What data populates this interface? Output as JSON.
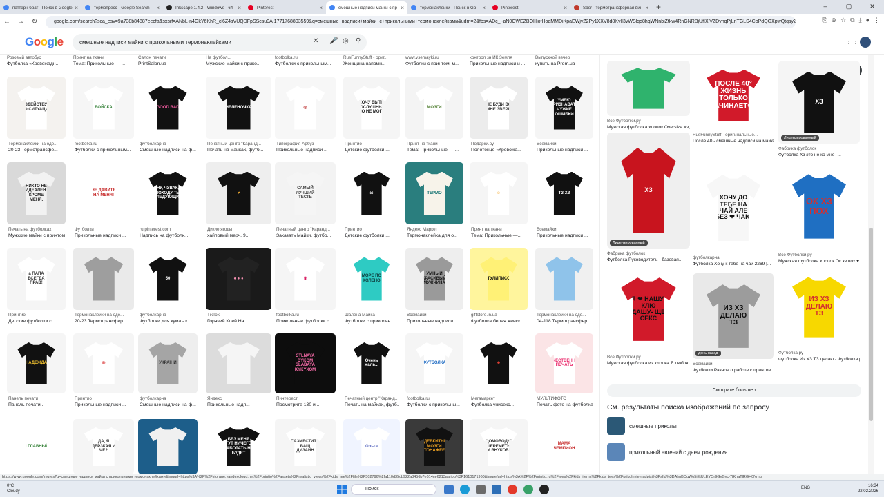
{
  "tabs": [
    {
      "title": "паттерн брат - Поиск в Google",
      "color": "#4285f4"
    },
    {
      "title": "термопресс - Google Search",
      "color": "#4285f4"
    },
    {
      "title": "Inkscape 1.4.2 - Windows - 64 -",
      "color": "#222222"
    },
    {
      "title": "Pinterest",
      "color": "#e60023"
    },
    {
      "title": "смешные надписи майки с пр",
      "color": "#4285f4"
    },
    {
      "title": "термонаклейки - Поиск в Go",
      "color": "#4285f4"
    },
    {
      "title": "Pinterest",
      "color": "#e60023"
    },
    {
      "title": "Sber - термотрансферная вин",
      "color": "#c0392b"
    }
  ],
  "window_controls": [
    "–",
    "▢",
    "✕"
  ],
  "address": {
    "url": "google.com/search?sca_esv=9a738b84887eecfa&sxsrf=ANbL-n4GkY6KhR_cl6Z4sVUQDFpSScsu0A:1771768803559&q=смешные+надписи+майки+с+прикольными+термонаклейками&udm=2&fbs=ADc_l-aN0CWEZBOHjofHoaMMDiKpaEWjvZ2Py1XXV8d8KvlI3vWSlqd8hqWNnbiZtkw4RnGNRBjUfIXiVZDvnqPjLnTGLS4CoPdQGXpwQtqsyZ84_ZWmpPpvwdl2dlNNdzrnETaAPpUeg6Mby_mwSwP-uaSHUNzd_q9XsYX8sJ7JIfhaaKPn8Z1MjPSi2hjRlNBxWtZY&sa=X&ved=2ahUKEwiZ5tGxitqSAxXLFBAIHdY9AIAQtKgLegQIEhAB&biw=1280&bih=720&dpr=1.5#vhid=ALYpb_ncDc7jTlmw6Mmq7NjuX5c-GJ1bPa4iXHT6GKBu-8TSmBbK7h36E7nAzGveWQCpQaLoTwnDwyEH_w_sfZ5vFUqcv_wXXPdX_tpUWwKaASDHNmpWc"
  },
  "google": {
    "logo": "Google",
    "query": "смешные надписи майки с прикольными термонаклейками"
  },
  "grid_top": {
    "sources": [
      "Розовый автобус",
      "Принт на ткани",
      "Салон печати",
      "На футбол...",
      "footbolka.ru",
      "RusFunnyStuff - ориг...",
      "www.vsemayki.ru",
      "контрол зн ИК Земля",
      "Выпускной вечер"
    ],
    "titles": [
      "Футболка «Кровожадн...",
      "Тема: Прикольные — ...",
      "PrintSalon.ua",
      "Мужские майки с прико...",
      "Футболки с прикольным...",
      "Женщина напомн...",
      "Футболки с принтом, м...",
      "Прикольные надписи и ...",
      "купить на Prom.ua"
    ]
  },
  "rows": [
    [
      {
        "bg": "#f4f2ef",
        "shirt": "#ffffff",
        "ink": "#333",
        "text": "БЕЗДЕЙСТВУЕМ ПО СИТУАЦИИ",
        "src": "Термонаклейки на оде...",
        "ttl": "20-23 Термотрансфе..."
      },
      {
        "bg": "#f6f6f6",
        "shirt": "#ffffff",
        "ink": "#2e7d32",
        "text": "ВОЙСКА",
        "src": "footbolka.ru",
        "ttl": "Футболки с прикольным..."
      },
      {
        "bg": "#ffffff",
        "shirt": "#111111",
        "ink": "#ff5ea8",
        "text": "GOOD BAD",
        "src": "футболкарна",
        "ttl": "Смешные надписи на ф..."
      },
      {
        "bg": "#f7f7f7",
        "shirt": "#111111",
        "ink": "#ffffff",
        "text": "НЕЛЕНОЧКА",
        "src": "Печатный центр \"Каранд...",
        "ttl": "Печать на майках, футб..."
      },
      {
        "bg": "#f7f7f7",
        "shirt": "#ffffff",
        "ink": "#b71c1c",
        "text": "◎",
        "src": "Типография Арбуз",
        "ttl": "Прикольные надписи ..."
      },
      {
        "bg": "#f5f5f5",
        "shirt": "#ffffff",
        "ink": "#222",
        "text": "ХОЧУ БЫТЬ ПОСЛУШНЫМ НО НЕ МОГУ",
        "src": "Принтио",
        "ttl": "Детские футболки ..."
      },
      {
        "bg": "#f4f4f4",
        "shirt": "#ffffff",
        "ink": "#4a7a2a",
        "text": "МОЗГИ",
        "src": "Принт на ткани",
        "ttl": "Тема: Прикольные — ..."
      },
      {
        "bg": "#ececec",
        "shirt": "#ffffff",
        "ink": "#333",
        "text": "НЕ БУДИ ВО МНЕ ЗВЕРЯ",
        "src": "Подарки.ру",
        "ttl": "Полотенце «Кровожа..."
      },
      {
        "bg": "#f5f5f5",
        "shirt": "#111111",
        "ink": "#ffffff",
        "text": "УМЕЮ ПРИЗНАВАТЬ ЧУЖИЕ ОШИБКИ",
        "src": "Всемайки",
        "ttl": "Прикольные надписи ..."
      }
    ],
    [
      {
        "bg": "#d9d9d9",
        "shirt": "#f2f2f2",
        "ink": "#222",
        "text": "НИКТО НЕ ИДЕАЛЕН. КРОМЕ МЕНЯ.",
        "src": "Печать на футболках",
        "ttl": "Мужские майки с принтом в Ми..."
      },
      {
        "bg": "#ffffff",
        "shirt": "#ffffff",
        "ink": "#c62828",
        "text": "НЕ ДАВИТЕ НА МЕНЯ!",
        "src": "Футболки",
        "ttl": "Прикольные надписи ..."
      },
      {
        "bg": "#ffffff",
        "shirt": "#111111",
        "ink": "#ffffff",
        "text": "НУ, ЧУВАК, ПОХОДУ ТЫ СЛЕДУЮЩИЙ",
        "src": "ru.pinterest.com",
        "ttl": "Надпись на футболк..."
      },
      {
        "bg": "#eeeeee",
        "shirt": "#111111",
        "ink": "#e0a030",
        "text": "♥",
        "src": "Дикие ягоды",
        "ttl": "хайповый мерч. 9..."
      },
      {
        "bg": "#f3f3f3",
        "shirt": "#f5f5f5",
        "ink": "#444",
        "text": "САМЫЙ ЛУЧШИЙ ТЕСТЬ",
        "src": "Печатный центр \"Каранд...",
        "ttl": "Заказать Майки, футбо..."
      },
      {
        "bg": "#ffffff",
        "shirt": "#111111",
        "ink": "#dddddd",
        "text": "☠",
        "src": "Принтио",
        "ttl": "Детские футболки ..."
      },
      {
        "bg": "#2a7e7e",
        "shirt": "#f7f3ea",
        "ink": "#0a6d6d",
        "text": "ТЕРМО",
        "src": "Яндекс Маркет",
        "ttl": "Термонаклейка для о..."
      },
      {
        "bg": "#f5f5f5",
        "shirt": "#ffffff",
        "ink": "#f5a623",
        "text": "☺",
        "src": "Принт на ткани",
        "ttl": "Тема: Прикольные —..."
      },
      {
        "bg": "#ffffff",
        "shirt": "#111111",
        "ink": "#ffffff",
        "text": "ТЗ ХЗ",
        "src": "Всемайки",
        "ttl": "Прикольные надписи ..."
      }
    ],
    [
      {
        "bg": "#f5f5f5",
        "shirt": "#ffffff",
        "ink": "#333",
        "text": "а ПАПА ВСЕГДА ПРАВ!",
        "src": "Принтио",
        "ttl": "Детские футболки с ..."
      },
      {
        "bg": "#eaeaea",
        "shirt": "#9e9e9e",
        "ink": "#222",
        "text": "",
        "src": "Термонаклейки на оде...",
        "ttl": "20-23 Термотрансфер ..."
      },
      {
        "bg": "#ffffff",
        "shirt": "#111111",
        "ink": "#ffffff",
        "text": "50",
        "src": "футболкарна",
        "ttl": "Футболки для кума - к..."
      },
      {
        "bg": "#1a1a1a",
        "shirt": "#222222",
        "ink": "#f48fb1",
        "text": "● ● ●",
        "src": "TikTok",
        "ttl": "Горячий Клей На ..."
      },
      {
        "bg": "#f5f5f5",
        "shirt": "#ffffff",
        "ink": "#d81b60",
        "text": "♛",
        "src": "footbolka.ru",
        "ttl": "Прикольные футболки с ..."
      },
      {
        "bg": "#ffffff",
        "shirt": "#2ecbc3",
        "ink": "#0d3b3b",
        "text": "МОРЕ ПО КОЛЕНО",
        "src": "Шалена Майка",
        "ttl": "Футболки с прикольн..."
      },
      {
        "bg": "#eeeeee",
        "shirt": "#9a9a9a",
        "ink": "#111",
        "text": "УМНЫЙ КРАСИВЫЙ МУЖЧИНА",
        "src": "Всемайки",
        "ttl": "Прикольные надписи ..."
      },
      {
        "bg": "#fff59d",
        "shirt": "#fff176",
        "ink": "#111",
        "text": "СТУЛИПИСОК",
        "src": "giftstore.in.ua",
        "ttl": "Футболка белая женск..."
      },
      {
        "bg": "#f0f0f0",
        "shirt": "#8fc3ea",
        "ink": "#234",
        "text": "",
        "src": "Термонаклейки на оде...",
        "ttl": "04-118 Термотрансфер..."
      }
    ],
    [
      {
        "bg": "#f5f5f5",
        "shirt": "#111111",
        "ink": "#f2c230",
        "text": "НАДЕЖДА",
        "src": "Панель печати",
        "ttl": "Панель печати..."
      },
      {
        "bg": "#f5f5f5",
        "shirt": "#ffffff",
        "ink": "#e57373",
        "text": "◉",
        "src": "Принтио",
        "ttl": "Прикольные надписи ..."
      },
      {
        "bg": "#eeeeee",
        "shirt": "#a5a5a5",
        "ink": "#333",
        "text": "УКРАЇНИ",
        "src": "футболкарна",
        "ttl": "Смешные надписи на ф..."
      },
      {
        "bg": "#dcdcdc",
        "shirt": "#f5f5f5",
        "ink": "#222",
        "text": "",
        "src": "Яндекс",
        "ttl": "Прикольные надп..."
      },
      {
        "bg": "#0d0d0d",
        "shirt": "#0d0d0d",
        "ink": "#ff6fae",
        "text": "STLNAYA DYKOM SLABAYA KYKYXOM",
        "src": "Пинтерест",
        "ttl": "Посмотрите 130 и..."
      },
      {
        "bg": "#ffffff",
        "shirt": "#111111",
        "ink": "#ffffff",
        "text": "Очень жаль...",
        "src": "Печатный центр \"Каранд...",
        "ttl": "Печать на майках, футб..."
      },
      {
        "bg": "#f5f5f5",
        "shirt": "#ffffff",
        "ink": "#1565c0",
        "text": "ФУТБОЛКА",
        "src": "footbolka.ru",
        "ttl": "Футболки с прикольны..."
      },
      {
        "bg": "#ffffff",
        "shirt": "#111111",
        "ink": "#f44336",
        "text": "☻",
        "src": "Мегамаркет",
        "ttl": "Футболка унисекс..."
      },
      {
        "bg": "#fbe4e6",
        "shirt": "#ffffff",
        "ink": "#e91e63",
        "text": "КАЧЕСТВЕННАЯ ПЕЧАТЬ",
        "src": "МУЛЬТИФОТО",
        "ttl": "Печать фото на футболках ..."
      }
    ],
    [
      {
        "bg": "#ffffff",
        "shirt": "#ffffff",
        "ink": "#2e7d32",
        "text": "Я ГЛАВНЫЙ",
        "src": "",
        "ttl": ""
      },
      {
        "bg": "#f5f5f5",
        "shirt": "#ffffff",
        "ink": "#222",
        "text": "ДА, Я ДЕРЗКАЯ И ЧЕ?",
        "src": "",
        "ttl": ""
      },
      {
        "bg": "#1d5e8a",
        "shirt": "#f0f0f0",
        "ink": "#d32f2f",
        "text": "",
        "src": "",
        "ttl": ""
      },
      {
        "bg": "#ffffff",
        "shirt": "#111111",
        "ink": "#ffffff",
        "text": "БЕЗ МЕНЯ ТУТ НИЧЕГО РАБОТАТЬ НЕ БУДЕТ",
        "src": "",
        "ttl": ""
      },
      {
        "bg": "#f5f5f5",
        "shirt": "#ffffff",
        "ink": "#333",
        "text": "РАЗМЕСТИТЬ ВАШ ДИЗАЙН",
        "src": "",
        "ttl": ""
      },
      {
        "bg": "#f0f4ff",
        "shirt": "#ffffff",
        "ink": "#5c6bc0",
        "text": "Ольга",
        "src": "",
        "ttl": ""
      },
      {
        "bg": "#3a3a3a",
        "shirt": "#111111",
        "ink": "#f5a623",
        "text": "ДЕВКИТЫ МОЗГИ ТОНАЖЕЕ",
        "src": "",
        "ttl": ""
      },
      {
        "bg": "#f5f5f5",
        "shirt": "#ffffff",
        "ink": "#222",
        "text": "ДОМОВОДЫ ШЕРЕМЕТЫ И ВНУКОВ!",
        "src": "",
        "ttl": ""
      },
      {
        "bg": "#ffffff",
        "shirt": "#ffffff",
        "ink": "#c62828",
        "text": "МАМА ЧЕМПИОН",
        "src": "",
        "ttl": ""
      }
    ]
  ],
  "side": {
    "close": "✕",
    "items": [
      {
        "bg": "#f3f3f3",
        "shirt": "#2fb36d",
        "ink": "#fff",
        "text": "",
        "src": "Все Футболки.ру",
        "ttl": "Мужская футболка хлопок Oversize Хз,...",
        "badge": ""
      },
      {
        "bg": "#ffffff",
        "shirt": "#d11a2a",
        "ink": "#ffffff",
        "text": "ПОСЛЕ 40° ЖИЗНЬ ТОЛЬКО НАЧИНАЕТСЯ",
        "src": "RusFunnyStuff - оригинальные...",
        "ttl": "После 40 - смешные надписи на майка...",
        "badge": ""
      },
      {
        "bg": "#f5f5f5",
        "shirt": "#111111",
        "ink": "#ffffff",
        "text": "ХЗ",
        "src": "Фабрика футболок",
        "ttl": "Футболка Хз это не ко мне -...",
        "badge": "Лицензированный"
      },
      {
        "bg": "#efefef",
        "shirt": "#c8141e",
        "ink": "#ffffff",
        "text": "ХЗ",
        "src": "Фабрика футболок",
        "ttl": "Футболка Руководитель - базовая...",
        "badge": "Лицензированный"
      },
      {
        "bg": "#ffffff",
        "shirt": "#f7f7f7",
        "ink": "#111",
        "text": "ХОЧУ ДО ТЕБЕ НА ЧАЙ АЛЕ БЕЗ ❤ ЧАЮ",
        "src": "футболкарна",
        "ttl": "Футболка Хочу к тебе на чай 2269 |...",
        "badge": ""
      },
      {
        "bg": "#ffffff",
        "shirt": "#1f6fc2",
        "ink": "#d32f2f",
        "text": "ОК ХЗ ПОХ",
        "src": "Все Футболки.ру",
        "ttl": "Мужская футболка хлопок Ок хз пох ♥...",
        "badge": ""
      },
      {
        "bg": "#ffffff",
        "shirt": "#d11a2a",
        "ink": "#111",
        "text": "Я ❤ НАШУ- КЛЮ ДАШУ- ЩЕ СЕКС",
        "src": "Все Футболки.ру",
        "ttl": "Мужская футболка из хлопка Я люблю...",
        "badge": ""
      },
      {
        "bg": "#e9e9e9",
        "shirt": "#9c9c9c",
        "ink": "#111",
        "text": "ИЗ ХЗ ДЕЛАЮ ТЗ",
        "src": "Всемайки",
        "ttl": "Футболки Разное о работе с принтом |...",
        "badge": "день назад"
      },
      {
        "bg": "#ffffff",
        "shirt": "#f7d800",
        "ink": "#d32f2f",
        "text": "ИЗ ХЗ ДЕЛАЮ ТЗ",
        "src": "Футболка.ру",
        "ttl": "Футболка Из ХЗ ТЗ делаю - Футболка.ру",
        "badge": ""
      }
    ],
    "more_button": "Смотрите больше",
    "see_results": "См. результаты поиска изображений по запросу",
    "related": [
      {
        "label": "смешные приколы",
        "color": "#2b5876"
      },
      {
        "label": "прикольный евгений с днем рождения",
        "color": "#5b86b8"
      }
    ]
  },
  "status_url": "https://www.google.com/imgres?q=смешные надписи майки с прикольными термонаклейками&imgurl=https%3A%2F%2Fstorage.yandexcloud.net%2Fprintio%2Fassets%2Frealistic_views%2Fkids_tee%2Ffile%2F502796%2fa110d35cb922a3456b7e614ce6213aa.jpg%3F1610171960&imgrefurl=https%3A%2F%2Fprintio.ru%2Ftees%2Fkids_items%2Fkids_tees%2Fprikolnyie-nadpisi%3Fsfid%3DAlmBQqWo5iEtULEYOr9GyGyc-7fKnaTlRGH0Nmgl",
  "taskbar": {
    "temp": "0°C",
    "weather": "Cloudy",
    "search": "Поиск",
    "lang": "ENG",
    "time": "16:34",
    "date": "22.02.2026"
  }
}
